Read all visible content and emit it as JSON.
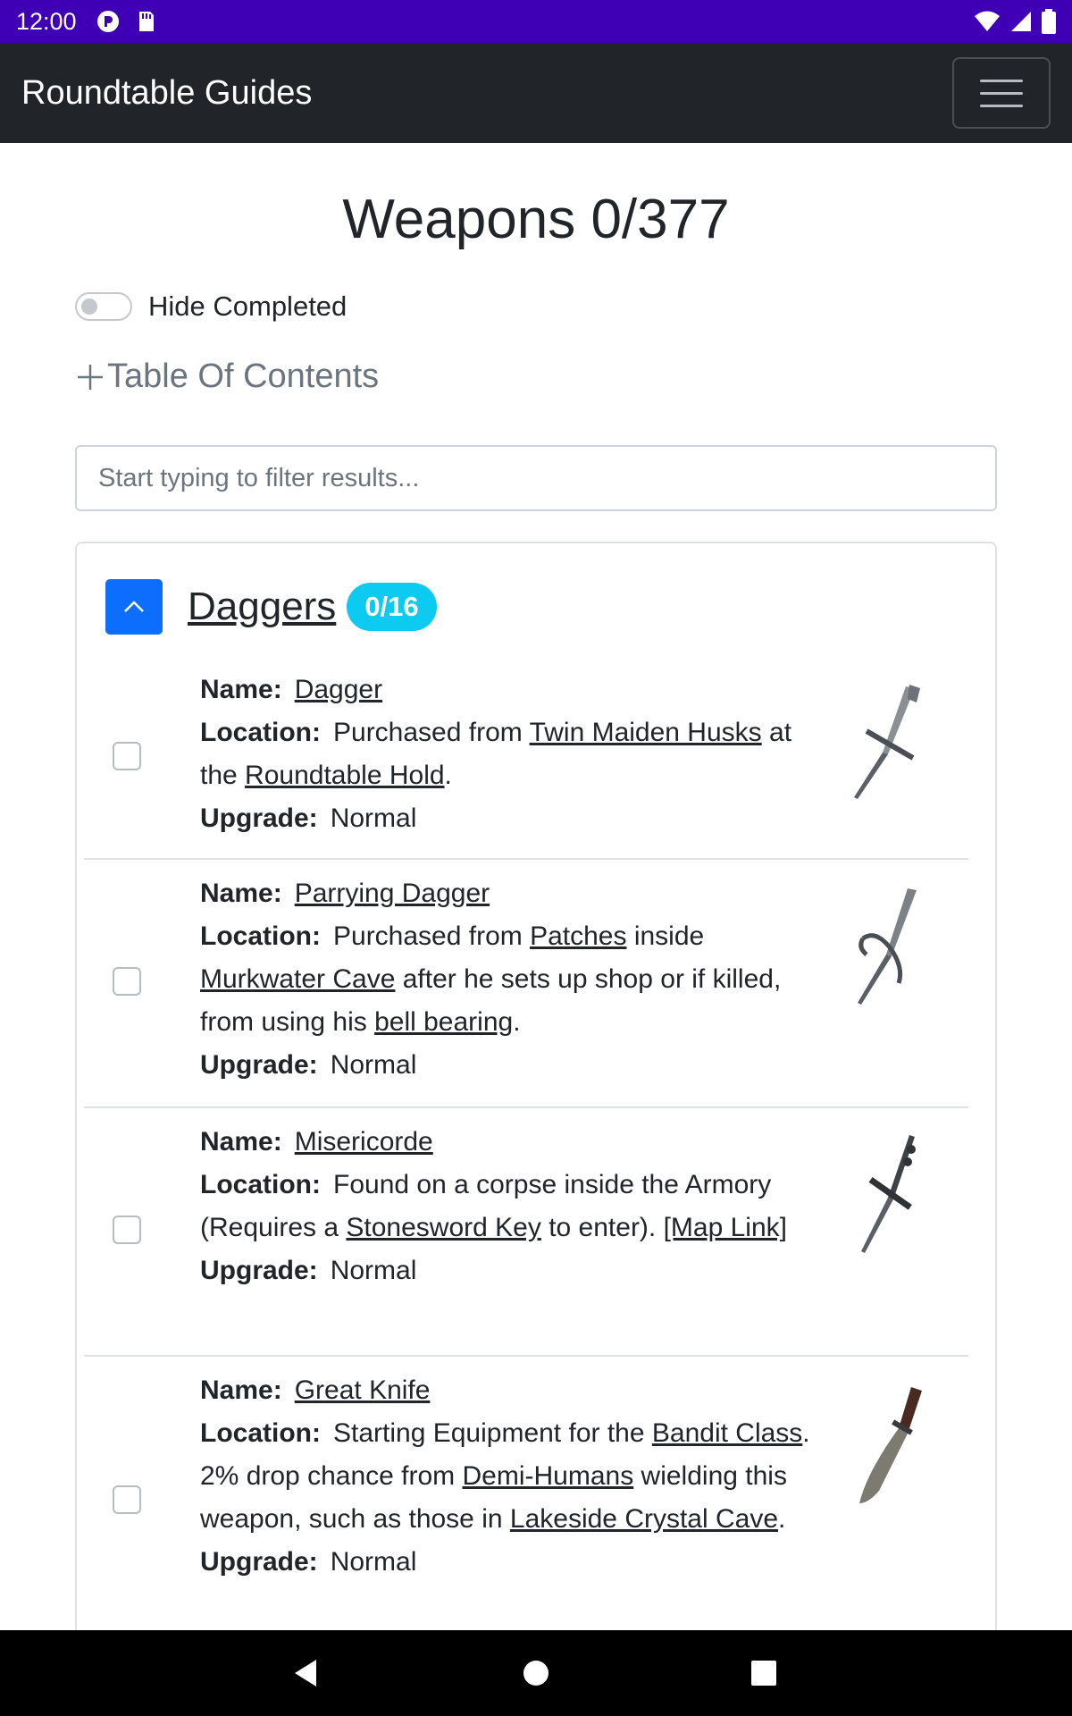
{
  "status_bar": {
    "time": "12:00"
  },
  "navbar": {
    "brand": "Roundtable Guides"
  },
  "page": {
    "title": "Weapons 0/377",
    "hide_completed_label": "Hide Completed",
    "hide_completed_on": false,
    "toc_label": "Table Of Contents",
    "filter_placeholder": "Start typing to filter results..."
  },
  "section": {
    "title": "Daggers",
    "count": "0/16"
  },
  "labels": {
    "name": "Name:",
    "location": "Location:",
    "upgrade": "Upgrade:"
  },
  "items": [
    {
      "name": "Dagger",
      "loc1": "Purchased from ",
      "link1": "Twin Maiden Husks",
      "loc2": " at the ",
      "link2": "Roundtable Hold",
      "loc3": ".",
      "upgrade": "Normal"
    },
    {
      "name": "Parrying Dagger",
      "loc1": "Purchased from ",
      "link1": "Patches",
      "loc2": " inside ",
      "link2": "Murkwater Cave",
      "loc3": " after he sets up shop or if killed, from using his ",
      "link3": "bell bearing",
      "loc4": ".",
      "upgrade": "Normal"
    },
    {
      "name": "Misericorde",
      "loc1": "Found on a corpse inside the Armory (Requires a ",
      "link1": "Stonesword Key",
      "loc2": " to enter). ",
      "link2": "[Map Link]",
      "upgrade": "Normal"
    },
    {
      "name": "Great Knife",
      "loc1": "Starting Equipment for the ",
      "link1": "Bandit Class",
      "loc2": ". 2% drop chance from ",
      "link2": "Demi-Humans",
      "loc3": " wielding this weapon, such as those in ",
      "link3": "Lakeside Crystal Cave",
      "loc4": ".",
      "upgrade": "Normal"
    }
  ]
}
